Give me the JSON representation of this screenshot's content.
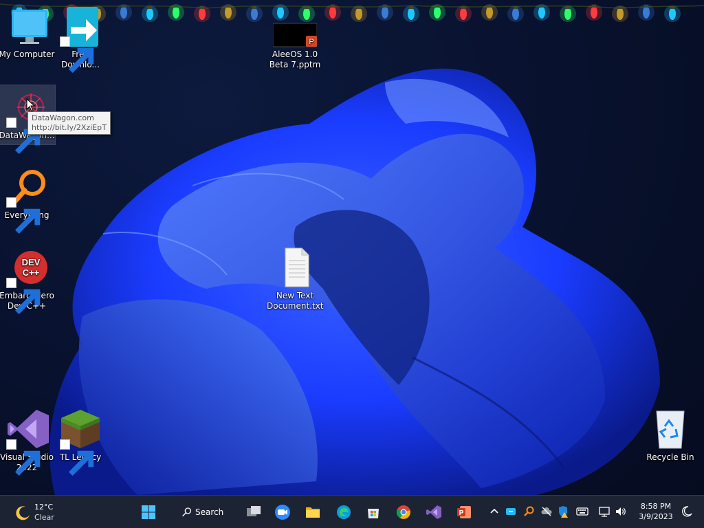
{
  "desktop": {
    "icons": [
      {
        "label": "My Computer"
      },
      {
        "label": "Free Downlo..."
      },
      {
        "label": "AleeOS 1.0 Beta 7.pptm"
      },
      {
        "label": "DataWagon..."
      },
      {
        "label": "Everything"
      },
      {
        "label": "Embarcadero Dev-C++"
      },
      {
        "label": "New Text Document.txt"
      },
      {
        "label": "Visual Studio 2022"
      },
      {
        "label": "TL Legacy"
      },
      {
        "label": "Recycle Bin"
      }
    ],
    "tooltip": {
      "line1": "DataWagon.com",
      "line2": "http://bit.ly/2XziEpT"
    },
    "devcpp_badge": "DEV C++"
  },
  "taskbar": {
    "weather": {
      "temp": "12°C",
      "condition": "Clear"
    },
    "search_label": "Search",
    "apps": [
      "start-icon",
      "search-icon",
      "task-view-icon",
      "zoom-icon",
      "file-explorer-icon",
      "edge-icon",
      "store-icon",
      "chrome-icon",
      "visual-studio-icon",
      "powerpoint-icon"
    ],
    "clock": {
      "time": "8:58 PM",
      "date": "3/9/2023"
    }
  },
  "colors": {
    "taskbar": "#1c2434",
    "wallpaper_blue": "#1a3cff",
    "accent": "#0067c0"
  }
}
